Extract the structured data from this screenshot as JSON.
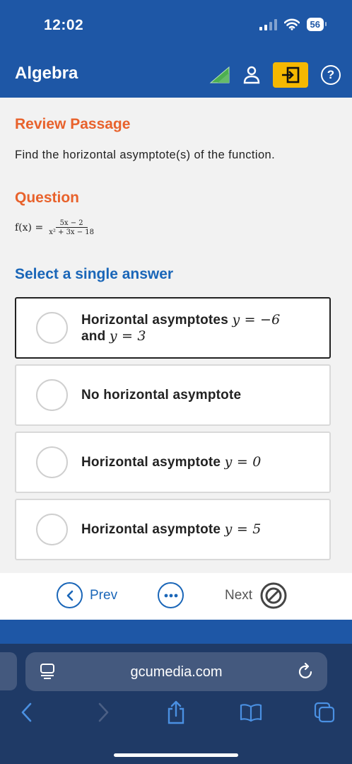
{
  "status": {
    "time": "12:02",
    "battery": "56"
  },
  "app": {
    "title": "Algebra"
  },
  "passage": {
    "heading": "Review Passage",
    "text": "Find the horizontal asymptote(s) of the function."
  },
  "question": {
    "heading": "Question",
    "lhs": "f(x) =",
    "numerator": "5x − 2",
    "denominator": "x² + 3x − 18"
  },
  "answers": {
    "heading": "Select a single answer",
    "options": [
      {
        "line1_text": "Horizontal asymptotes ",
        "line1_math": "y = −6",
        "line2_text": "and ",
        "line2_math": "y = 3",
        "selected": true
      },
      {
        "text": "No horizontal asymptote",
        "math": ""
      },
      {
        "text": "Horizontal asymptote ",
        "math": "y = 0"
      },
      {
        "text": "Horizontal asymptote ",
        "math": "y = 5"
      }
    ]
  },
  "nav": {
    "prev_label": "Prev",
    "next_label": "Next"
  },
  "browser": {
    "url": "gcumedia.com"
  },
  "colors": {
    "header_blue": "#1e57a6",
    "accent_orange": "#e8622c",
    "link_blue": "#1a66b8",
    "exit_yellow": "#f5b800",
    "progress_green": "#4caf50"
  },
  "icons": [
    "signal-icon",
    "wifi-icon",
    "battery-icon",
    "progress-triangle-icon",
    "user-icon",
    "exit-icon",
    "help-icon",
    "chevron-left-icon",
    "more-icon",
    "disabled-icon",
    "reader-icon",
    "reload-icon",
    "back-icon",
    "forward-icon",
    "share-icon",
    "bookmarks-icon",
    "tabs-icon"
  ]
}
